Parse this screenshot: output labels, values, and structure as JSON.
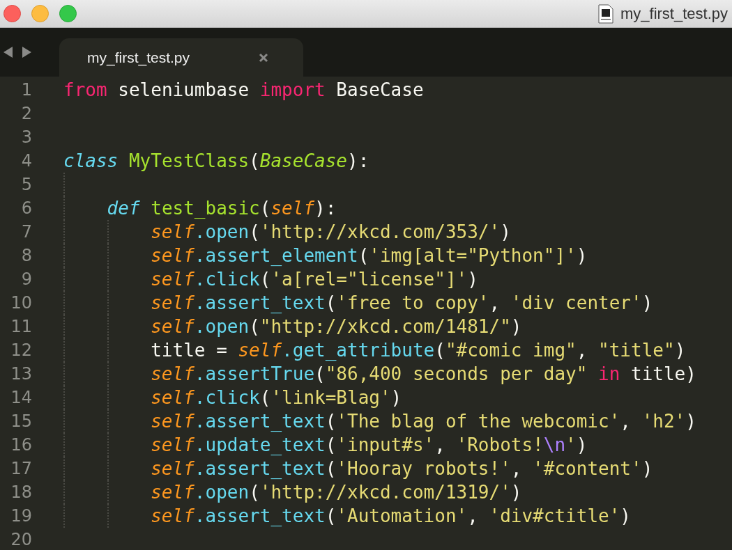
{
  "window": {
    "title": "my_first_test.py"
  },
  "tabs": [
    {
      "label": "my_first_test.py",
      "selected": true
    }
  ],
  "editor": {
    "lines": [
      {
        "number": "1",
        "tokens": [
          {
            "text": "from",
            "kind": "keyword"
          },
          {
            "text": " seleniumbase ",
            "kind": "plain"
          },
          {
            "text": "import",
            "kind": "keyword"
          },
          {
            "text": " BaseCase",
            "kind": "plain"
          }
        ]
      },
      {
        "number": "2"
      },
      {
        "number": "3"
      },
      {
        "number": "4",
        "tokens": [
          {
            "text": "class ",
            "kind": "storage"
          },
          {
            "text": "MyTestClass",
            "kind": "entity"
          },
          {
            "text": "(",
            "kind": "plain"
          },
          {
            "text": "BaseCase",
            "kind": "inherited"
          },
          {
            "text": "):",
            "kind": "plain"
          }
        ],
        "children": [
          {
            "number": "5"
          },
          {
            "number": "6",
            "tokens": [
              {
                "text": "def ",
                "kind": "storage"
              },
              {
                "text": "test_basic",
                "kind": "entity"
              },
              {
                "text": "(",
                "kind": "plain"
              },
              {
                "text": "self",
                "kind": "param"
              },
              {
                "text": "):",
                "kind": "plain"
              }
            ],
            "children": [
              {
                "number": "7",
                "tokens": [
                  {
                    "text": "self",
                    "kind": "param"
                  },
                  {
                    "text": ".open",
                    "kind": "func"
                  },
                  {
                    "text": "(",
                    "kind": "plain"
                  },
                  {
                    "text": "'http://xkcd.com/353/'",
                    "kind": "string"
                  },
                  {
                    "text": ")",
                    "kind": "plain"
                  }
                ]
              },
              {
                "number": "8",
                "tokens": [
                  {
                    "text": "self",
                    "kind": "param"
                  },
                  {
                    "text": ".assert_element",
                    "kind": "func"
                  },
                  {
                    "text": "(",
                    "kind": "plain"
                  },
                  {
                    "text": "'img[alt=\"Python\"]'",
                    "kind": "string"
                  },
                  {
                    "text": ")",
                    "kind": "plain"
                  }
                ]
              },
              {
                "number": "9",
                "tokens": [
                  {
                    "text": "self",
                    "kind": "param"
                  },
                  {
                    "text": ".click",
                    "kind": "func"
                  },
                  {
                    "text": "(",
                    "kind": "plain"
                  },
                  {
                    "text": "'a[rel=\"license\"]'",
                    "kind": "string"
                  },
                  {
                    "text": ")",
                    "kind": "plain"
                  }
                ]
              },
              {
                "number": "10",
                "tokens": [
                  {
                    "text": "self",
                    "kind": "param"
                  },
                  {
                    "text": ".assert_text",
                    "kind": "func"
                  },
                  {
                    "text": "(",
                    "kind": "plain"
                  },
                  {
                    "text": "'free to copy'",
                    "kind": "string"
                  },
                  {
                    "text": ", ",
                    "kind": "plain"
                  },
                  {
                    "text": "'div center'",
                    "kind": "string"
                  },
                  {
                    "text": ")",
                    "kind": "plain"
                  }
                ]
              },
              {
                "number": "11",
                "tokens": [
                  {
                    "text": "self",
                    "kind": "param"
                  },
                  {
                    "text": ".open",
                    "kind": "func"
                  },
                  {
                    "text": "(",
                    "kind": "plain"
                  },
                  {
                    "text": "\"http://xkcd.com/1481/\"",
                    "kind": "string"
                  },
                  {
                    "text": ")",
                    "kind": "plain"
                  }
                ]
              },
              {
                "number": "12",
                "tokens": [
                  {
                    "text": "title = ",
                    "kind": "plain"
                  },
                  {
                    "text": "self",
                    "kind": "param"
                  },
                  {
                    "text": ".get_attribute",
                    "kind": "func"
                  },
                  {
                    "text": "(",
                    "kind": "plain"
                  },
                  {
                    "text": "\"#comic img\"",
                    "kind": "string"
                  },
                  {
                    "text": ", ",
                    "kind": "plain"
                  },
                  {
                    "text": "\"title\"",
                    "kind": "string"
                  },
                  {
                    "text": ")",
                    "kind": "plain"
                  }
                ]
              },
              {
                "number": "13",
                "tokens": [
                  {
                    "text": "self",
                    "kind": "param"
                  },
                  {
                    "text": ".assertTrue",
                    "kind": "func"
                  },
                  {
                    "text": "(",
                    "kind": "plain"
                  },
                  {
                    "text": "\"86,400 seconds per day\" ",
                    "kind": "string"
                  },
                  {
                    "text": "in",
                    "kind": "keyword"
                  },
                  {
                    "text": " title)",
                    "kind": "plain"
                  }
                ]
              },
              {
                "number": "14",
                "tokens": [
                  {
                    "text": "self",
                    "kind": "param"
                  },
                  {
                    "text": ".click",
                    "kind": "func"
                  },
                  {
                    "text": "(",
                    "kind": "plain"
                  },
                  {
                    "text": "'link=Blag'",
                    "kind": "string"
                  },
                  {
                    "text": ")",
                    "kind": "plain"
                  }
                ]
              },
              {
                "number": "15",
                "tokens": [
                  {
                    "text": "self",
                    "kind": "param"
                  },
                  {
                    "text": ".assert_text",
                    "kind": "func"
                  },
                  {
                    "text": "(",
                    "kind": "plain"
                  },
                  {
                    "text": "'The blag of the webcomic'",
                    "kind": "string"
                  },
                  {
                    "text": ", ",
                    "kind": "plain"
                  },
                  {
                    "text": "'h2'",
                    "kind": "string"
                  },
                  {
                    "text": ")",
                    "kind": "plain"
                  }
                ]
              },
              {
                "number": "16",
                "tokens": [
                  {
                    "text": "self",
                    "kind": "param"
                  },
                  {
                    "text": ".update_text",
                    "kind": "func"
                  },
                  {
                    "text": "(",
                    "kind": "plain"
                  },
                  {
                    "text": "'input#s'",
                    "kind": "string"
                  },
                  {
                    "text": ", ",
                    "kind": "plain"
                  },
                  {
                    "text": "'Robots!",
                    "kind": "string"
                  },
                  {
                    "text": "\\n",
                    "kind": "escape"
                  },
                  {
                    "text": "'",
                    "kind": "string"
                  },
                  {
                    "text": ")",
                    "kind": "plain"
                  }
                ]
              },
              {
                "number": "17",
                "tokens": [
                  {
                    "text": "self",
                    "kind": "param"
                  },
                  {
                    "text": ".assert_text",
                    "kind": "func"
                  },
                  {
                    "text": "(",
                    "kind": "plain"
                  },
                  {
                    "text": "'Hooray robots!'",
                    "kind": "string"
                  },
                  {
                    "text": ", ",
                    "kind": "plain"
                  },
                  {
                    "text": "'#content'",
                    "kind": "string"
                  },
                  {
                    "text": ")",
                    "kind": "plain"
                  }
                ]
              },
              {
                "number": "18",
                "tokens": [
                  {
                    "text": "self",
                    "kind": "param"
                  },
                  {
                    "text": ".open",
                    "kind": "func"
                  },
                  {
                    "text": "(",
                    "kind": "plain"
                  },
                  {
                    "text": "'http://xkcd.com/1319/'",
                    "kind": "string"
                  },
                  {
                    "text": ")",
                    "kind": "plain"
                  }
                ]
              },
              {
                "number": "19",
                "tokens": [
                  {
                    "text": "self",
                    "kind": "param"
                  },
                  {
                    "text": ".assert_text",
                    "kind": "func"
                  },
                  {
                    "text": "(",
                    "kind": "plain"
                  },
                  {
                    "text": "'Automation'",
                    "kind": "string"
                  },
                  {
                    "text": ", ",
                    "kind": "plain"
                  },
                  {
                    "text": "'div#ctitle'",
                    "kind": "string"
                  },
                  {
                    "text": ")",
                    "kind": "plain"
                  }
                ]
              }
            ]
          }
        ]
      },
      {
        "number": "20"
      }
    ]
  }
}
